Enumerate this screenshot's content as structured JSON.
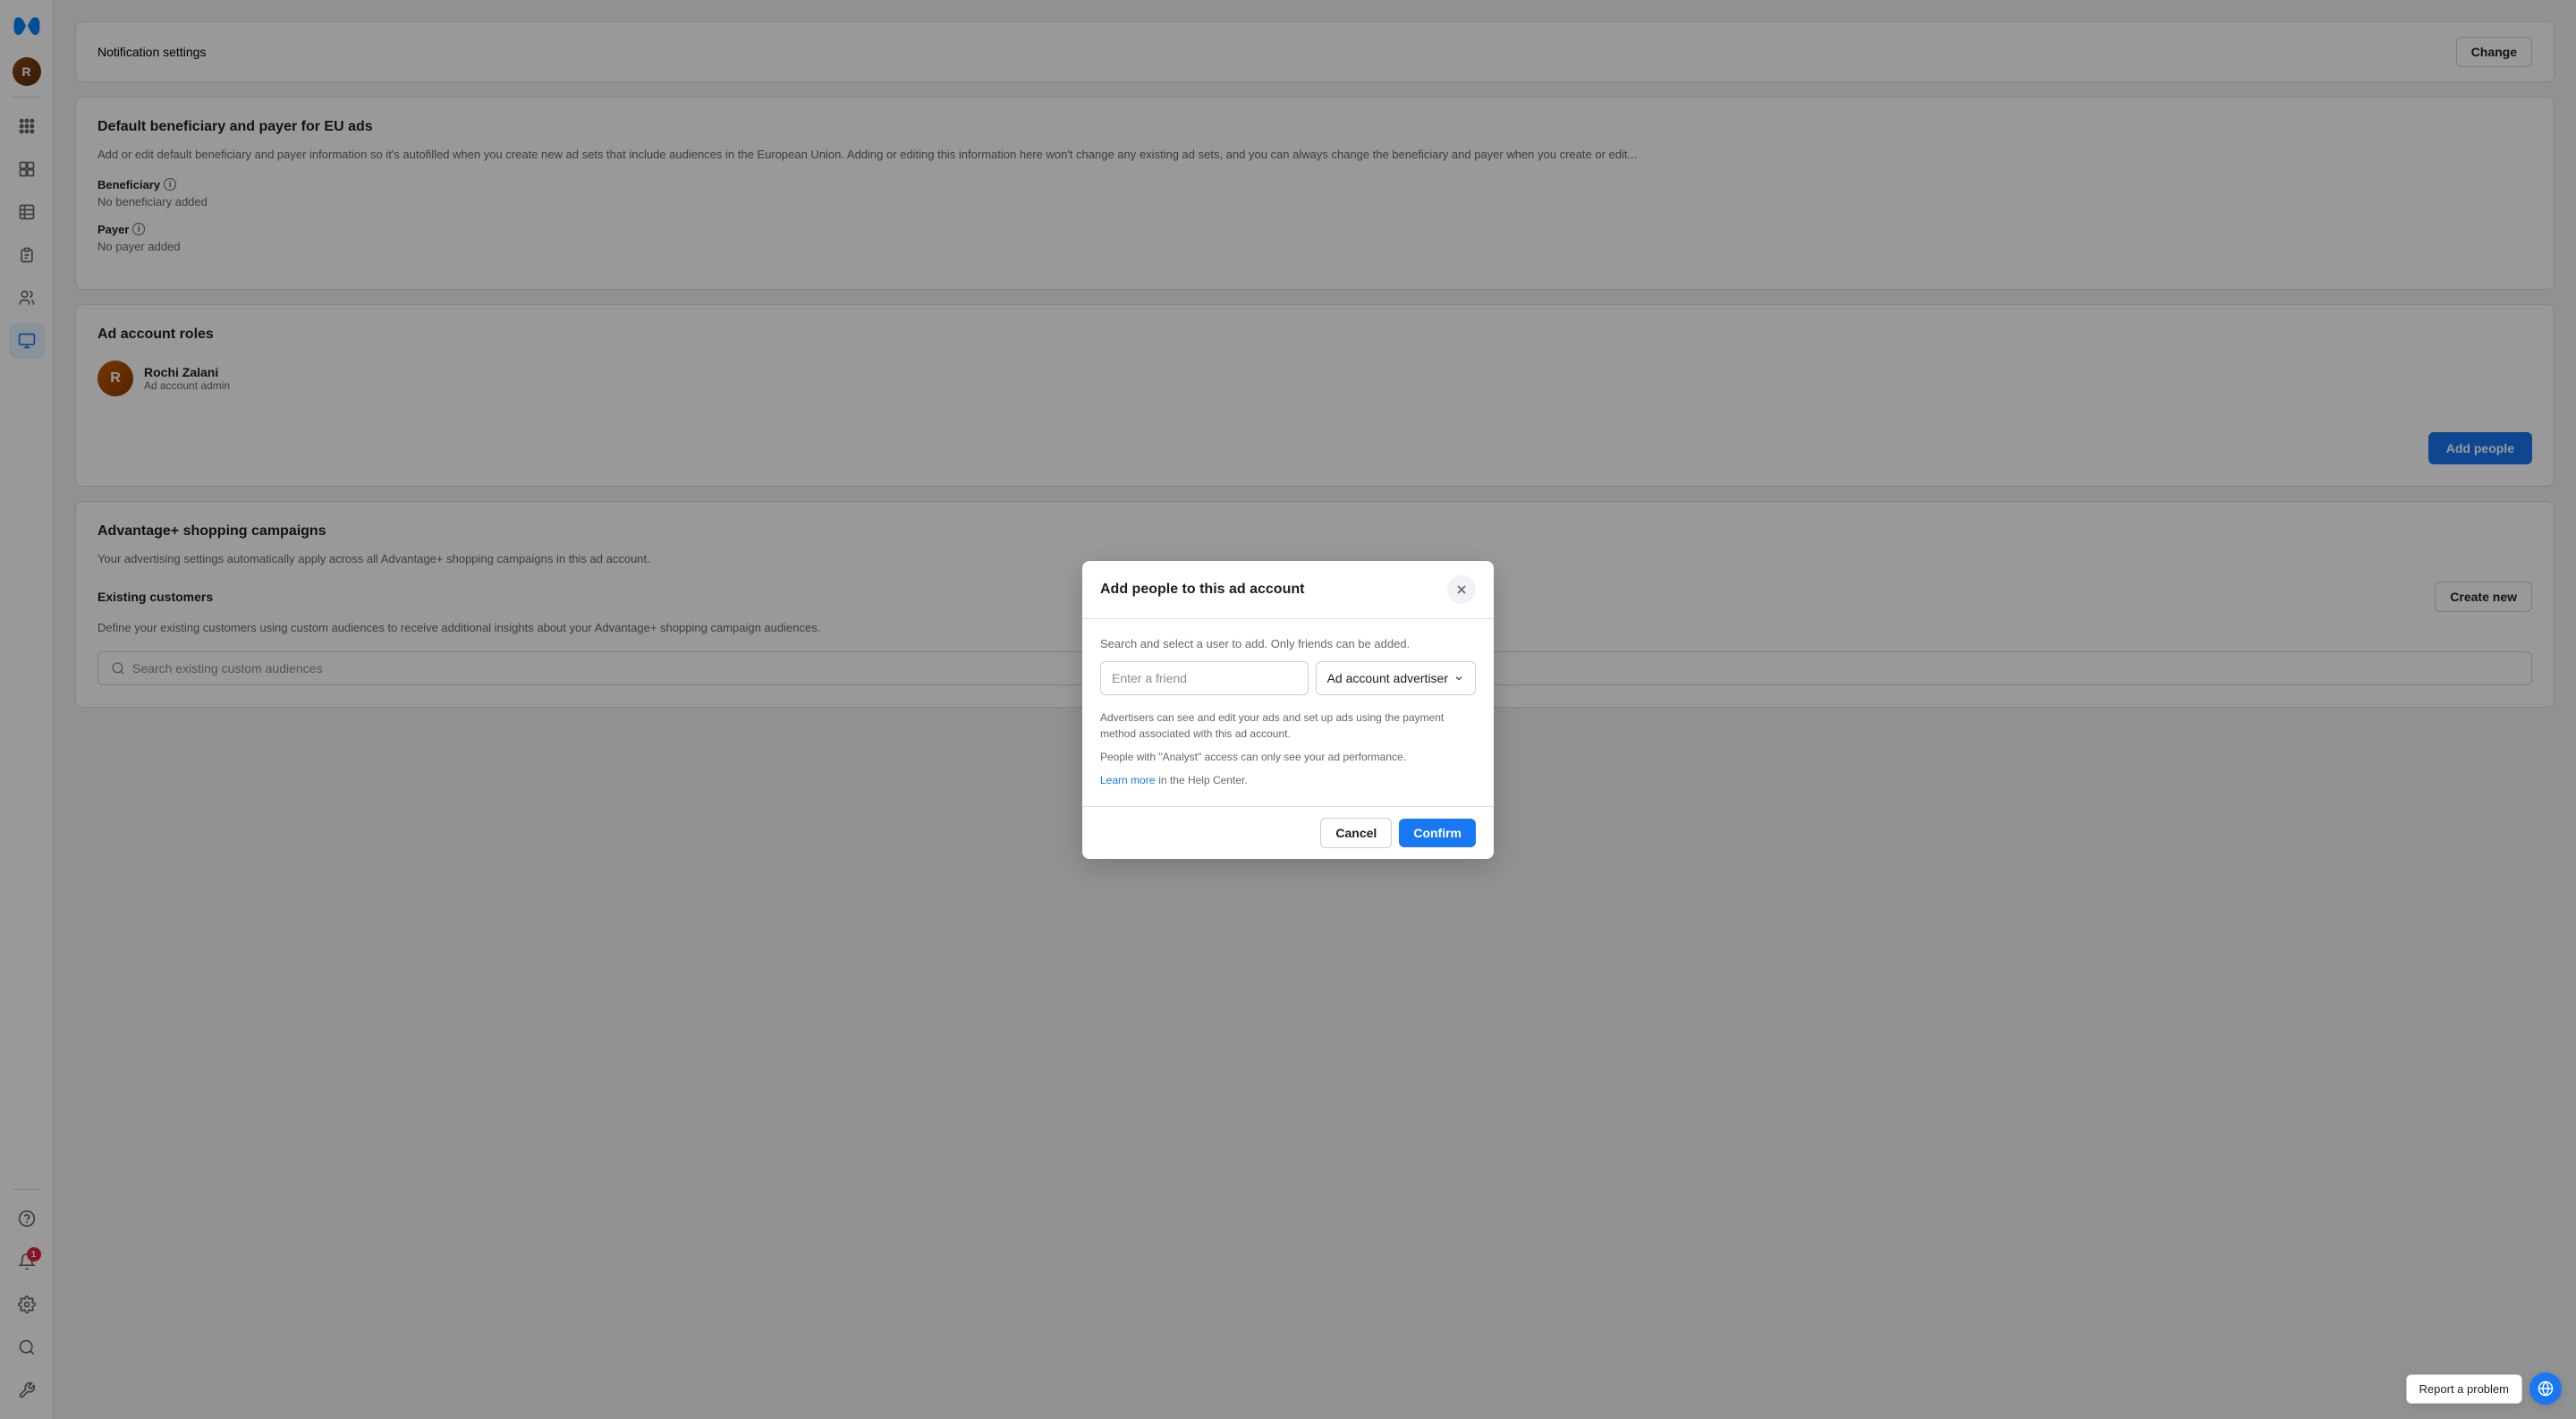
{
  "sidebar": {
    "logo_color": "#1877f2",
    "icons": [
      {
        "name": "home-icon",
        "label": "Home",
        "active": false
      },
      {
        "name": "grid-icon",
        "label": "Grid",
        "active": false
      },
      {
        "name": "table-icon",
        "label": "Table",
        "active": false
      },
      {
        "name": "reports-icon",
        "label": "Reports",
        "active": false
      },
      {
        "name": "people-icon",
        "label": "People",
        "active": false
      },
      {
        "name": "ads-icon",
        "label": "Ads",
        "active": true
      }
    ],
    "bottom_icons": [
      {
        "name": "help-icon",
        "label": "Help"
      },
      {
        "name": "notifications-icon",
        "label": "Notifications",
        "badge": "1"
      },
      {
        "name": "settings-icon",
        "label": "Settings"
      },
      {
        "name": "search-icon",
        "label": "Search"
      },
      {
        "name": "tools-icon",
        "label": "Tools"
      }
    ]
  },
  "partial_top_card": {
    "label": "Notification settings",
    "button_label": "Change"
  },
  "beneficiary_card": {
    "title": "Default beneficiary and payer for EU ads",
    "description": "Add or edit default beneficiary and payer information so it's autofilled when you create new ad sets that include audiences in the European Union. Adding or editing this information here won't change any existing ad sets, and you can always change the beneficiary and payer when you create or edit...",
    "beneficiary_label": "Beneficiary",
    "beneficiary_value": "No beneficiary added",
    "payer_label": "Payer",
    "payer_value": "No payer added"
  },
  "ad_account_roles_card": {
    "title": "Ad account roles",
    "person": {
      "name": "Rochi Zalani",
      "role": "Ad account admin"
    },
    "add_people_button": "Add people"
  },
  "advantage_card": {
    "title": "Advantage+ shopping campaigns",
    "description": "Your advertising settings automatically apply across all Advantage+ shopping campaigns in this ad account.",
    "existing_customers_title": "Existing customers",
    "create_new_button": "Create new",
    "customers_desc": "Define your existing customers using custom audiences to receive additional insights about your Advantage+ shopping campaign audiences.",
    "search_placeholder": "Search existing custom audiences"
  },
  "modal": {
    "title": "Add people to this ad account",
    "description": "Search and select a user to add. Only friends can be added.",
    "input_placeholder": "Enter a friend",
    "role_label": "Ad account advertiser",
    "advertiser_info": "Advertisers can see and edit your ads and set up ads using the payment method associated with this ad account.",
    "analyst_info": "People with \"Analyst\" access can only see your ad performance.",
    "learn_more_text": "Learn more",
    "help_center_text": "in the Help Center.",
    "cancel_button": "Cancel",
    "confirm_button": "Confirm"
  },
  "report_bar": {
    "report_label": "Report a problem"
  }
}
